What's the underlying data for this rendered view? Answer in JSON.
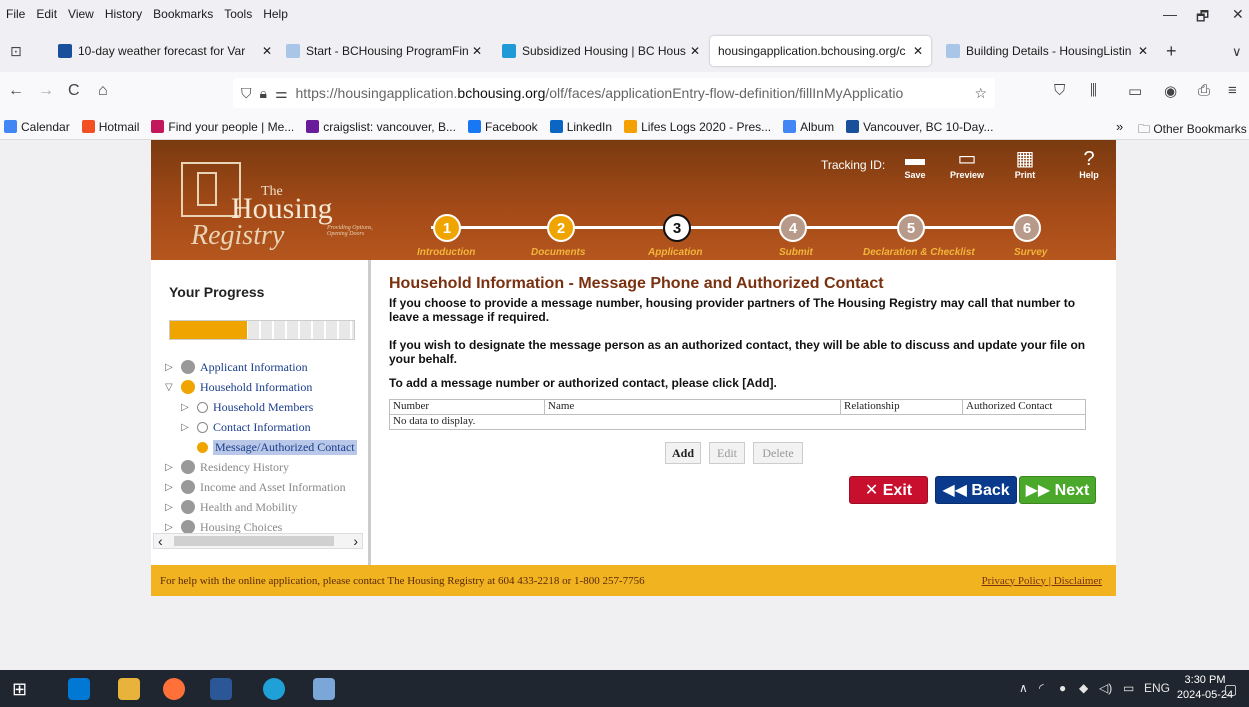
{
  "menubar": {
    "items": [
      "File",
      "Edit",
      "View",
      "History",
      "Bookmarks",
      "Tools",
      "Help"
    ],
    "min": "—",
    "restore": "🗗",
    "close": "✕"
  },
  "tabs": [
    {
      "title": "10-day weather forecast for Var",
      "color": "#1a4f9c"
    },
    {
      "title": "Start - BCHousing ProgramFind",
      "color": "#a9c6e8"
    },
    {
      "title": "Subsidized Housing | BC Housin",
      "color": "#1f9ad6"
    },
    {
      "title": "housingapplication.bchousing.org/c",
      "color": "#ffffff"
    },
    {
      "title": "Building Details - HousingListin",
      "color": "#a9c6e8"
    }
  ],
  "tab_close": "✕",
  "new_tab": "+",
  "tab_list": "∨",
  "nav": {
    "back": "←",
    "forward": "→",
    "reload": "C",
    "home": "⌂",
    "url_prefix": "https://housingapplication.",
    "url_domain": "bchousing.org",
    "url_rest": "/olf/faces/applicationEntry-flow-definition/fillInMyApplicatio",
    "star": "☆"
  },
  "bookmarks": [
    {
      "label": "Calendar",
      "color": "#4285f4"
    },
    {
      "label": "Hotmail",
      "color": "#f25022"
    },
    {
      "label": "Find your people | Me...",
      "color": "#c2185b"
    },
    {
      "label": "craigslist: vancouver, B...",
      "color": "#6a1b9a"
    },
    {
      "label": "Facebook",
      "color": "#1877f2"
    },
    {
      "label": "LinkedIn",
      "color": "#0a66c2"
    },
    {
      "label": "Lifes Logs 2020 - Pres...",
      "color": "#f4a000"
    },
    {
      "label": "Album",
      "color": "#4285f4"
    },
    {
      "label": "Vancouver, BC 10-Day...",
      "color": "#1a4f9c"
    }
  ],
  "bookmarks_more": "»",
  "other_bookmarks": "Other Bookmarks",
  "header": {
    "logo_the": "The",
    "logo_housing": "Housing",
    "logo_registry": "Registry",
    "logo_tagline": "Providing Options, Opening Doors",
    "tracking_label": "Tracking ID:",
    "tools": [
      {
        "label": "Save",
        "glyph": "▬"
      },
      {
        "label": "Preview",
        "glyph": "▭"
      },
      {
        "label": "Print",
        "glyph": "▦"
      },
      {
        "label": "Help",
        "glyph": "?"
      }
    ],
    "steps": [
      {
        "num": "1",
        "label": "Introduction",
        "state": "done"
      },
      {
        "num": "2",
        "label": "Documents",
        "state": "done"
      },
      {
        "num": "3",
        "label": "Application",
        "state": "current"
      },
      {
        "num": "4",
        "label": "Submit",
        "state": "todo"
      },
      {
        "num": "5",
        "label": "Declaration & Checklist",
        "state": "todo"
      },
      {
        "num": "6",
        "label": "Survey",
        "state": "todo"
      }
    ]
  },
  "sidebar": {
    "title": "Your Progress",
    "progress_fraction": 0.42,
    "items": [
      {
        "label": "Applicant Information",
        "level": 0,
        "twisty": "▷",
        "state": "normal"
      },
      {
        "label": "Household Information",
        "level": 0,
        "twisty": "▽",
        "state": "active"
      },
      {
        "label": "Household Members",
        "level": 1,
        "twisty": "▷",
        "state": "sub"
      },
      {
        "label": "Contact Information",
        "level": 1,
        "twisty": "▷",
        "state": "sub"
      },
      {
        "label": "Message/Authorized Contact",
        "level": 1,
        "twisty": "",
        "state": "selected"
      },
      {
        "label": "Residency History",
        "level": 0,
        "twisty": "▷",
        "state": "dim"
      },
      {
        "label": "Income and Asset Information",
        "level": 0,
        "twisty": "▷",
        "state": "dim"
      },
      {
        "label": "Health and Mobility",
        "level": 0,
        "twisty": "▷",
        "state": "dim"
      },
      {
        "label": "Housing Choices",
        "level": 0,
        "twisty": "▷",
        "state": "dim"
      }
    ],
    "scroll_left": "‹",
    "scroll_right": "›"
  },
  "main": {
    "heading": "Household Information - Message Phone and Authorized Contact",
    "para1": "If you choose to provide a message number, housing provider partners of The Housing Registry may call that number to leave a message if required.",
    "para2": "If you wish to designate the message person as an authorized contact, they will be able to discuss and update your file on your behalf.",
    "para3": "To add a message number or authorized contact, please click [Add].",
    "columns": [
      "Number",
      "Name",
      "Relationship",
      "Authorized Contact"
    ],
    "empty_text": "No data to display.",
    "add": "Add",
    "edit": "Edit",
    "delete": "Delete",
    "exit": "✕ Exit",
    "back": "◀◀ Back",
    "next": "▶▶ Next"
  },
  "footer": {
    "help": "For help with the online application, please contact The Housing Registry at 604 433-2218 or 1-800 257-7756",
    "links": "Privacy Policy | Disclaimer"
  },
  "taskbar": {
    "lang": "ENG",
    "time": "3:30 PM",
    "date": "2024-05-24"
  },
  "colors": {
    "exit_btn": "#c8102e",
    "back_btn": "#0a3a8c",
    "next_btn": "#4aa82a",
    "step_done": "#f0a400",
    "step_todo": "#b89a8a",
    "footer": "#f1b320"
  }
}
